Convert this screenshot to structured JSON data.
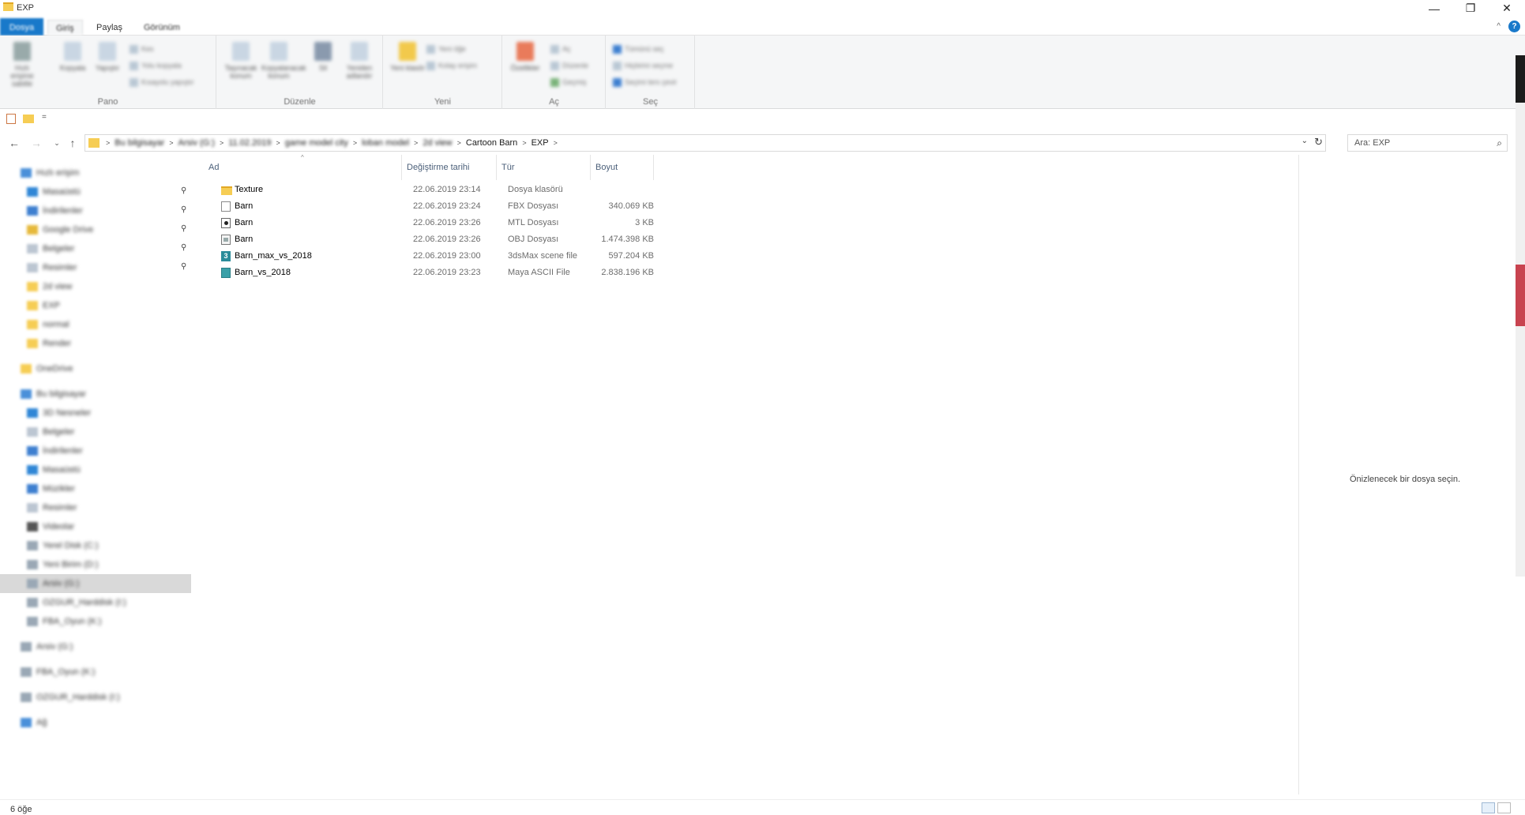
{
  "window": {
    "title": "EXP",
    "minimize_label": "—",
    "maximize_label": "❐",
    "close_label": "✕"
  },
  "ribbon": {
    "tabs": [
      {
        "label": "Dosya"
      },
      {
        "label": "Giriş"
      },
      {
        "label": "Paylaş"
      },
      {
        "label": "Görünüm"
      }
    ],
    "help_label": "?",
    "collapse_label": "^",
    "groups": [
      {
        "label": "Pano"
      },
      {
        "label": "Düzenle"
      },
      {
        "label": "Yeni"
      },
      {
        "label": "Aç"
      },
      {
        "label": "Seç"
      }
    ],
    "buttons": {
      "pin": "Hızlı erişime sabitle",
      "copy": "Kopyala",
      "paste": "Yapıştır",
      "cut": "Kes",
      "copy_path": "Yolu kopyala",
      "paste_shortcut": "Kısayolu yapıştır",
      "move_to": "Taşınacak konum",
      "copy_to": "Kopyalanacak konum",
      "delete": "Sil",
      "rename": "Yeniden adlandır",
      "new_folder": "Yeni klasör",
      "new_item": "Yeni öğe",
      "easy_access": "Kolay erişim",
      "properties": "Özellikler",
      "open": "Aç",
      "edit": "Düzenle",
      "history": "Geçmiş",
      "select_all": "Tümünü seç",
      "select_none": "Hiçbirini seçme",
      "invert_selection": "Seçimi ters çevir"
    }
  },
  "quick_access_toolbar": {
    "dropdown": "="
  },
  "address": {
    "breadcrumbs": [
      {
        "label": "Bu bilgisayar",
        "blurred": true
      },
      {
        "label": "Arsiv (G:)",
        "blurred": true
      },
      {
        "label": "11.02.2019",
        "blurred": true
      },
      {
        "label": "game model city",
        "blurred": true
      },
      {
        "label": "loban model",
        "blurred": true
      },
      {
        "label": "2d view",
        "blurred": true
      },
      {
        "label": "Cartoon Barn",
        "blurred": false
      },
      {
        "label": "EXP",
        "blurred": false
      }
    ],
    "search_placeholder": "Ara: EXP"
  },
  "nav_pane": {
    "items": [
      {
        "label": "Hızlı erişim",
        "indent": 1,
        "pinned": false,
        "color": "#4a90d9"
      },
      {
        "label": "Masaüstü",
        "indent": 2,
        "pinned": true,
        "color": "#2f86d6"
      },
      {
        "label": "İndirilenler",
        "indent": 2,
        "pinned": true,
        "color": "#3d7fd0"
      },
      {
        "label": "Google Drive",
        "indent": 2,
        "pinned": true,
        "color": "#e6b93b"
      },
      {
        "label": "Belgeler",
        "indent": 2,
        "pinned": true,
        "color": "#bcc6d2"
      },
      {
        "label": "Resimler",
        "indent": 2,
        "pinned": true,
        "color": "#bcc6d2"
      },
      {
        "label": "2d view",
        "indent": 2,
        "pinned": false,
        "color": "#f6cd54"
      },
      {
        "label": "EXP",
        "indent": 2,
        "pinned": false,
        "color": "#f6cd54"
      },
      {
        "label": "normal",
        "indent": 2,
        "pinned": false,
        "color": "#f6cd54"
      },
      {
        "label": "Render",
        "indent": 2,
        "pinned": false,
        "color": "#f6cd54"
      },
      {
        "label": "OneDrive",
        "indent": 1,
        "pinned": false,
        "color": "#f6cd54",
        "gap": true
      },
      {
        "label": "Bu bilgisayar",
        "indent": 1,
        "pinned": false,
        "color": "#4a90d9",
        "gap": true
      },
      {
        "label": "3D Nesneler",
        "indent": 2,
        "pinned": false,
        "color": "#2f86d6"
      },
      {
        "label": "Belgeler",
        "indent": 2,
        "pinned": false,
        "color": "#bcc6d2"
      },
      {
        "label": "İndirilenler",
        "indent": 2,
        "pinned": false,
        "color": "#3d7fd0"
      },
      {
        "label": "Masaüstü",
        "indent": 2,
        "pinned": false,
        "color": "#2f86d6"
      },
      {
        "label": "Müzikler",
        "indent": 2,
        "pinned": false,
        "color": "#3d7fd0"
      },
      {
        "label": "Resimler",
        "indent": 2,
        "pinned": false,
        "color": "#bcc6d2"
      },
      {
        "label": "Videolar",
        "indent": 2,
        "pinned": false,
        "color": "#555555"
      },
      {
        "label": "Yerel Disk (C:)",
        "indent": 2,
        "pinned": false,
        "color": "#9aa8b5"
      },
      {
        "label": "Yeni Birim (D:)",
        "indent": 2,
        "pinned": false,
        "color": "#9aa8b5"
      },
      {
        "label": "Arsiv (G:)",
        "indent": 2,
        "pinned": false,
        "color": "#9aa8b5",
        "selected": true
      },
      {
        "label": "OZGUR_Harddisk (I:)",
        "indent": 2,
        "pinned": false,
        "color": "#9aa8b5"
      },
      {
        "label": "FBA_Oyun (K:)",
        "indent": 2,
        "pinned": false,
        "color": "#9aa8b5"
      },
      {
        "label": "Arsiv (G:)",
        "indent": 1,
        "pinned": false,
        "color": "#9aa8b5",
        "gap": true
      },
      {
        "label": "FBA_Oyun (K:)",
        "indent": 1,
        "pinned": false,
        "color": "#9aa8b5",
        "gap": true
      },
      {
        "label": "OZGUR_Harddisk (I:)",
        "indent": 1,
        "pinned": false,
        "color": "#9aa8b5",
        "gap": true
      },
      {
        "label": "Ağ",
        "indent": 1,
        "pinned": false,
        "color": "#4a90d9",
        "gap": true
      }
    ]
  },
  "file_list": {
    "columns": [
      {
        "label": "Ad"
      },
      {
        "label": "Değiştirme tarihi"
      },
      {
        "label": "Tür"
      },
      {
        "label": "Boyut"
      }
    ],
    "rows": [
      {
        "name": "Texture",
        "date": "22.06.2019 23:14",
        "type": "Dosya klasörü",
        "size": "",
        "icon": "folder-icon"
      },
      {
        "name": "Barn",
        "date": "22.06.2019 23:24",
        "type": "FBX Dosyası",
        "size": "340.069 KB",
        "icon": "fbx-file-icon"
      },
      {
        "name": "Barn",
        "date": "22.06.2019 23:26",
        "type": "MTL Dosyası",
        "size": "3 KB",
        "icon": "mtl-file-icon"
      },
      {
        "name": "Barn",
        "date": "22.06.2019 23:26",
        "type": "OBJ Dosyası",
        "size": "1.474.398 KB",
        "icon": "obj-file-icon"
      },
      {
        "name": "Barn_max_vs_2018",
        "date": "22.06.2019 23:00",
        "type": "3dsMax scene file",
        "size": "597.204 KB",
        "icon": "3dsmax-file-icon"
      },
      {
        "name": "Barn_vs_2018",
        "date": "22.06.2019 23:23",
        "type": "Maya ASCII File",
        "size": "2.838.196 KB",
        "icon": "maya-file-icon"
      }
    ]
  },
  "preview": {
    "message": "Önizlenecek bir dosya seçin."
  },
  "status": {
    "item_count": "6 öğe"
  }
}
